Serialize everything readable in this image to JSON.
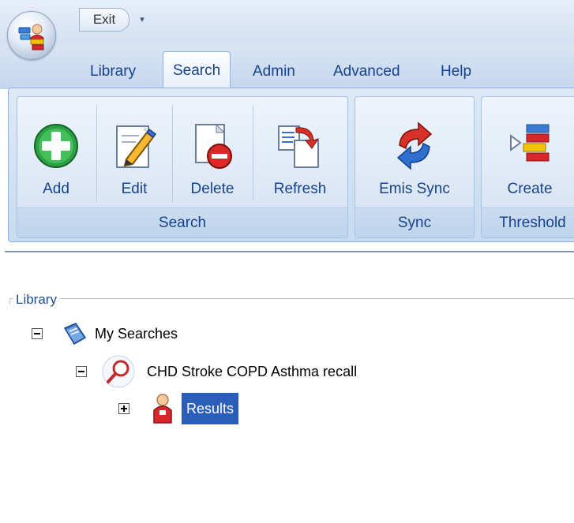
{
  "quick_access": {
    "exit_label": "Exit",
    "dropdown_glyph": "▾"
  },
  "tabs": [
    {
      "label": "Library",
      "active": false
    },
    {
      "label": "Search",
      "active": true
    },
    {
      "label": "Admin",
      "active": false
    },
    {
      "label": "Advanced",
      "active": false
    },
    {
      "label": "Help",
      "active": false
    }
  ],
  "ribbon": {
    "groups": [
      {
        "label": "Search",
        "buttons": [
          {
            "label": "Add",
            "icon": "add-icon"
          },
          {
            "label": "Edit",
            "icon": "edit-icon"
          },
          {
            "label": "Delete",
            "icon": "delete-icon"
          },
          {
            "label": "Refresh",
            "icon": "refresh-icon"
          }
        ]
      },
      {
        "label": "Sync",
        "buttons": [
          {
            "label": "Emis Sync",
            "icon": "sync-icon"
          }
        ]
      },
      {
        "label": "Threshold",
        "buttons": [
          {
            "label": "Create",
            "icon": "threshold-create-icon"
          }
        ]
      }
    ]
  },
  "library": {
    "legend": "Library",
    "tree": [
      {
        "label": "My Searches",
        "icon": "my-searches-icon",
        "expanded": true
      },
      {
        "label": "CHD Stroke COPD Asthma recall",
        "icon": "search-magnifier-icon",
        "expanded": true
      },
      {
        "label": "Results",
        "icon": "patient-results-icon",
        "expanded": false,
        "selected": true
      }
    ]
  },
  "colors": {
    "ribbon_text": "#15428b",
    "selection": "#2b5dbb",
    "ribbon_border": "#8db2e3"
  }
}
